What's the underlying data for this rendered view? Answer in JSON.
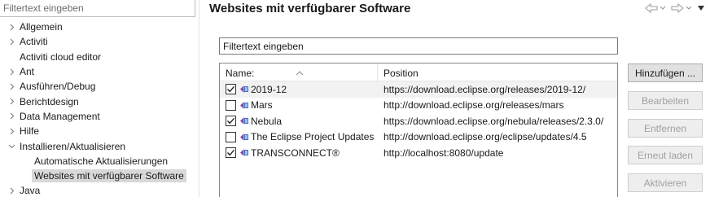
{
  "left": {
    "filter_placeholder": "Filtertext eingeben",
    "tree": [
      {
        "label": "Allgemein",
        "expandable": true,
        "expanded": false,
        "child": false
      },
      {
        "label": "Activiti",
        "expandable": true,
        "expanded": false,
        "child": false
      },
      {
        "label": "Activiti cloud editor",
        "expandable": false,
        "expanded": false,
        "child": false
      },
      {
        "label": "Ant",
        "expandable": true,
        "expanded": false,
        "child": false
      },
      {
        "label": "Ausführen/Debug",
        "expandable": true,
        "expanded": false,
        "child": false
      },
      {
        "label": "Berichtdesign",
        "expandable": true,
        "expanded": false,
        "child": false
      },
      {
        "label": "Data Management",
        "expandable": true,
        "expanded": false,
        "child": false
      },
      {
        "label": "Hilfe",
        "expandable": true,
        "expanded": false,
        "child": false
      },
      {
        "label": "Installieren/Aktualisieren",
        "expandable": true,
        "expanded": true,
        "child": false
      },
      {
        "label": "Automatische Aktualisierungen",
        "expandable": false,
        "expanded": false,
        "child": true
      },
      {
        "label": "Websites mit verfügbarer Software",
        "expandable": false,
        "expanded": false,
        "child": true,
        "selected": true
      },
      {
        "label": "Java",
        "expandable": true,
        "expanded": false,
        "child": false
      }
    ]
  },
  "page": {
    "title": "Websites mit verfügbarer Software",
    "nav_icons": [
      "back-arrow-icon",
      "chevron-down-icon",
      "forward-arrow-icon",
      "chevron-down-icon",
      "view-menu-icon"
    ],
    "filter_value": "Filtertext eingeben"
  },
  "table": {
    "columns": [
      "Name:",
      "Position"
    ],
    "rows": [
      {
        "checked": true,
        "name": "2019-12",
        "position": "https://download.eclipse.org/releases/2019-12/"
      },
      {
        "checked": false,
        "name": "Mars",
        "position": "http://download.eclipse.org/releases/mars"
      },
      {
        "checked": true,
        "name": "Nebula",
        "position": "https://download.eclipse.org/nebula/releases/2.3.0/"
      },
      {
        "checked": false,
        "name": "The Eclipse Project Updates",
        "position": "http://download.eclipse.org/eclipse/updates/4.5"
      },
      {
        "checked": true,
        "name": "TRANSCONNECT®",
        "position": "http://localhost:8080/update"
      }
    ]
  },
  "buttons": [
    {
      "label": "Hinzufügen ...",
      "enabled": true
    },
    {
      "label": "Bearbeiten",
      "enabled": false
    },
    {
      "label": "Entfernen",
      "enabled": false
    },
    {
      "label": "Erneut laden",
      "enabled": false
    },
    {
      "label": "Aktivieren",
      "enabled": false
    }
  ],
  "colors": {
    "selection": "#d8d8d8",
    "icon_purple": "#7b52a6",
    "icon_blue": "#3f6fc6"
  }
}
